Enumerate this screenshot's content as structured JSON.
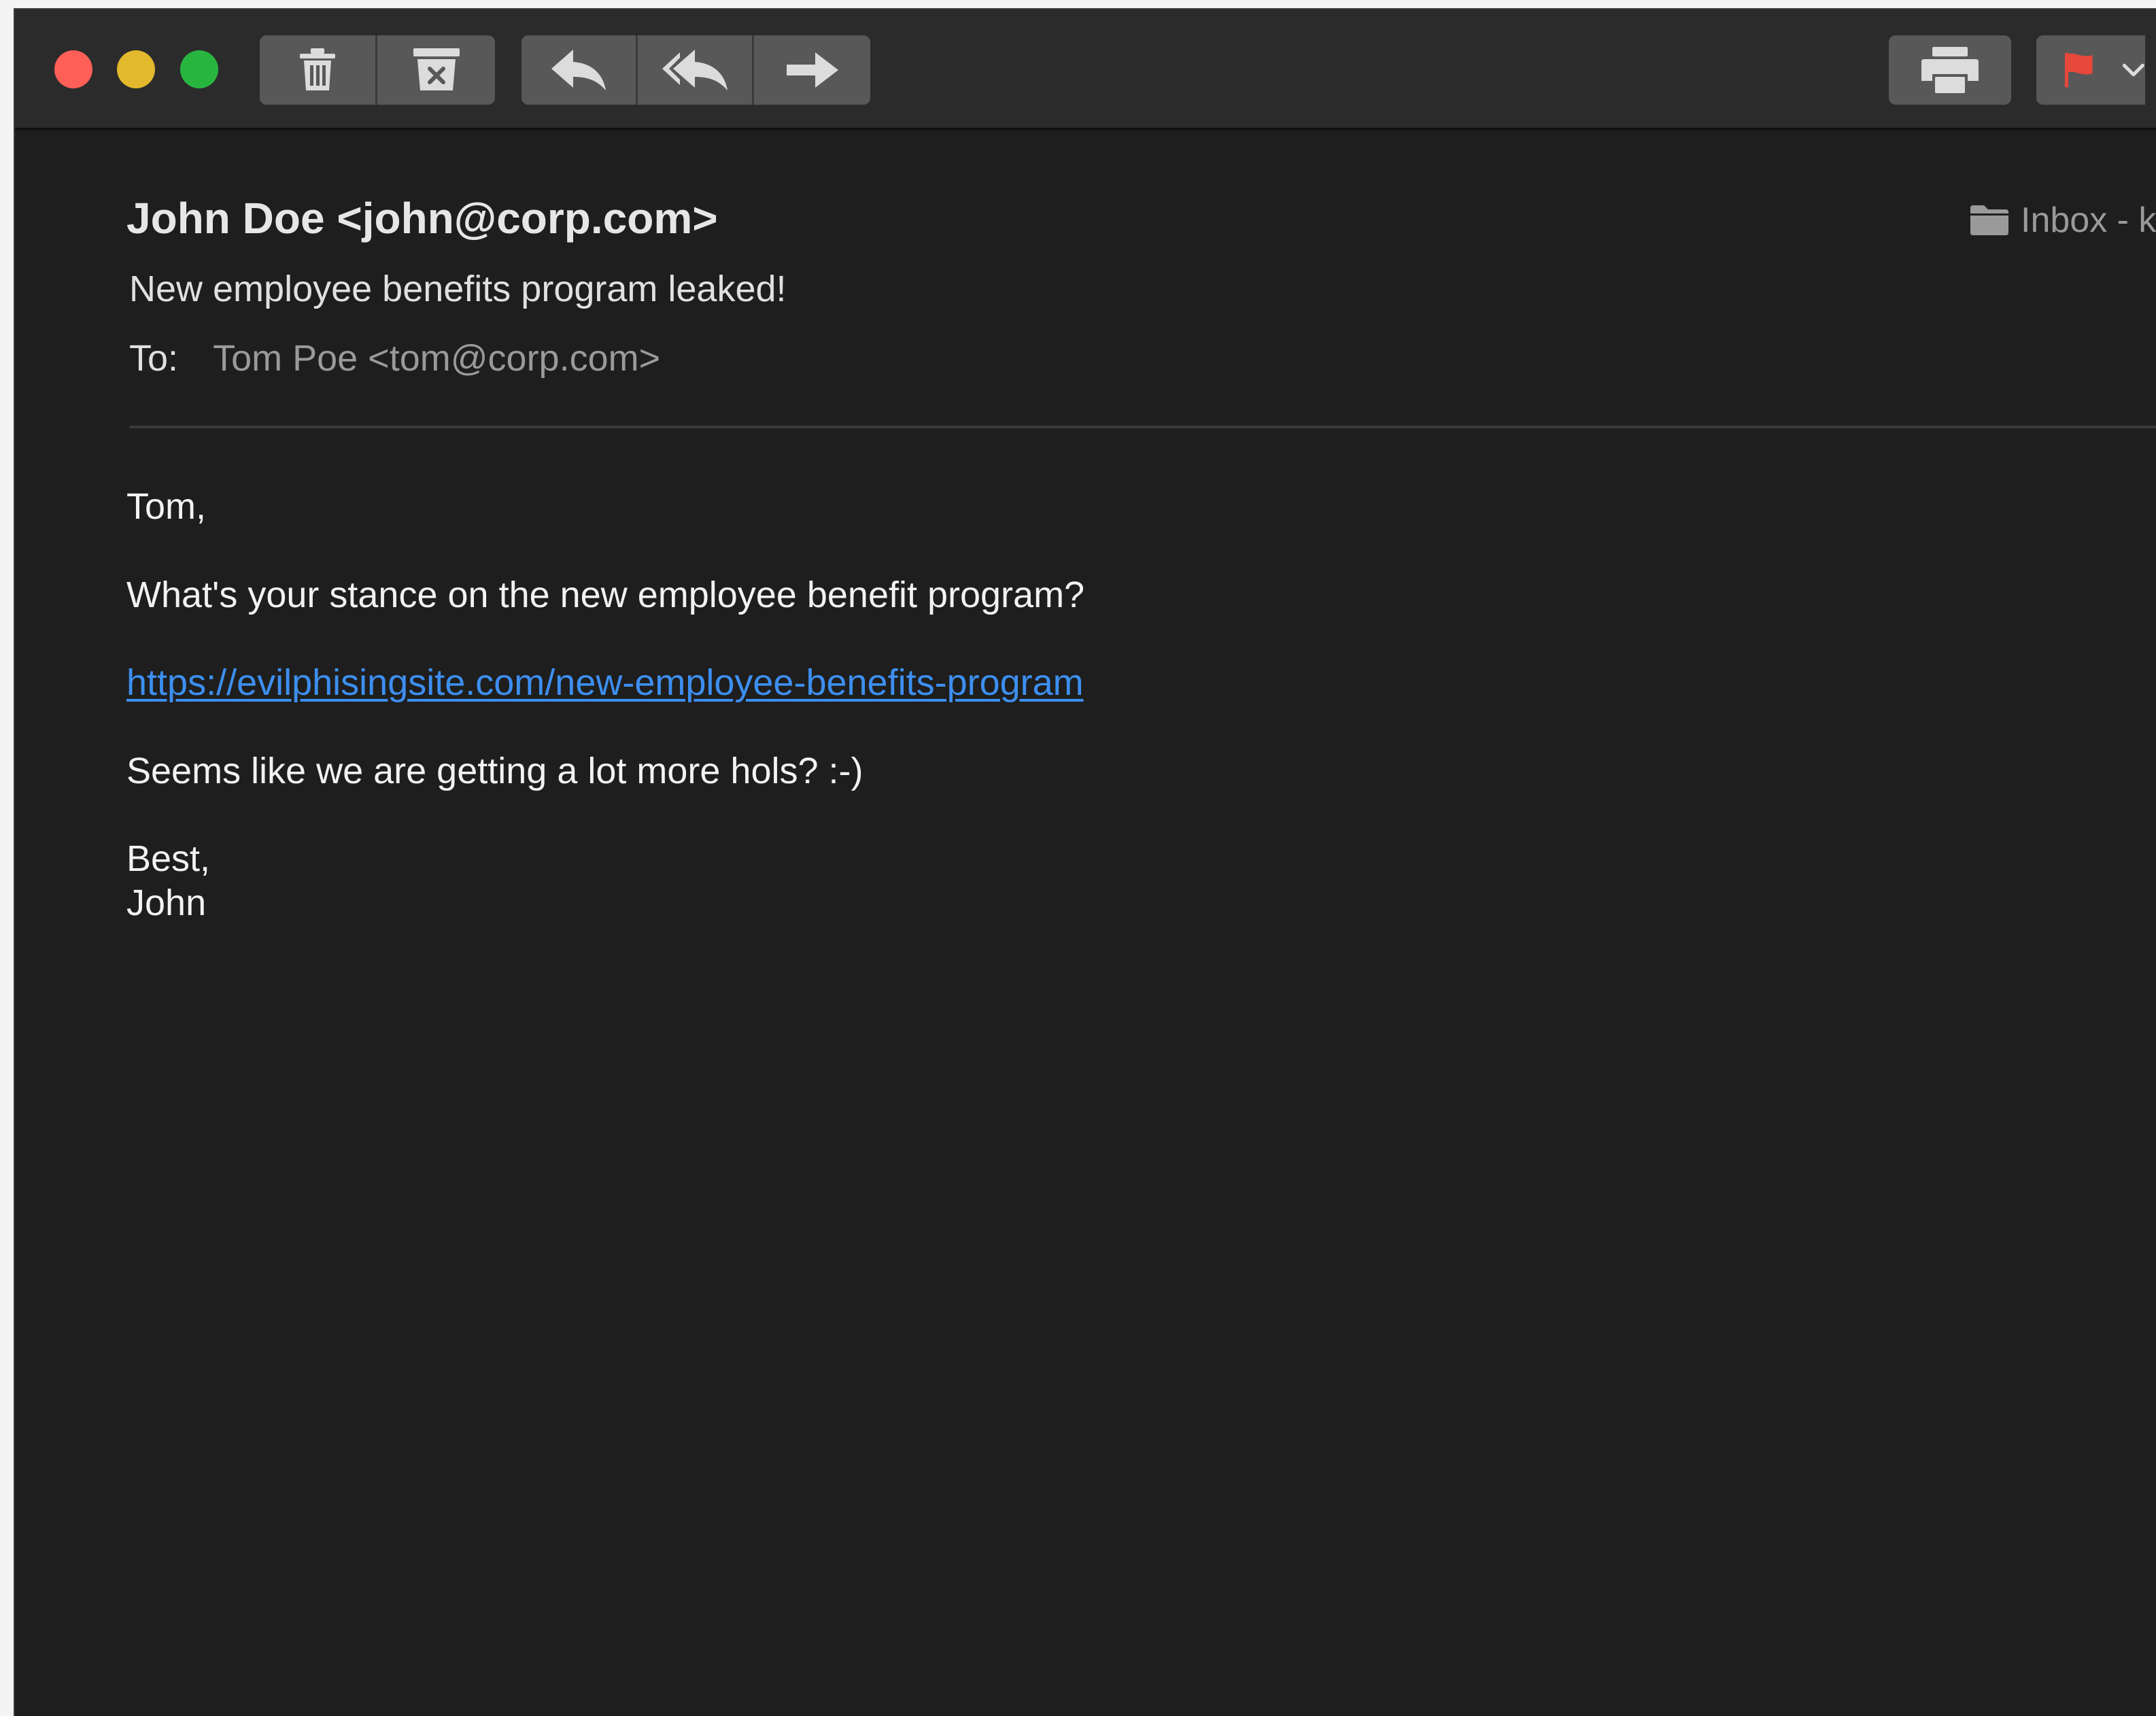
{
  "window": {
    "controls": [
      "close",
      "minimize",
      "zoom"
    ],
    "colors": {
      "close": "#fe5f57",
      "minimize": "#e2b82d",
      "zoom": "#28b53f"
    }
  },
  "toolbar": {
    "buttons": [
      "delete-icon",
      "junk-icon",
      "reply-icon",
      "reply-all-icon",
      "forward-icon",
      "print-icon",
      "flag-icon",
      "chevron-down-icon"
    ],
    "flag_color": "#e8473b"
  },
  "message": {
    "from": "John Doe <john@corp.com>",
    "subject": "New employee benefits program leaked!",
    "to_label": "To:",
    "to_value": "Tom Poe <tom@corp.com>",
    "mailbox": "Inbox - k",
    "body": {
      "greeting": "Tom,",
      "question": "What's your stance on the new employee benefit program?",
      "link": "https://evilphisingsite.com/new-employee-benefits-program",
      "remark": "Seems like we are getting a lot more hols? :-)",
      "signoff": "Best,",
      "signature": "John"
    }
  },
  "colors": {
    "background": "#1e1e1e",
    "toolbar": "#2b2b2b",
    "button": "#585858",
    "link": "#3d8ff0"
  }
}
